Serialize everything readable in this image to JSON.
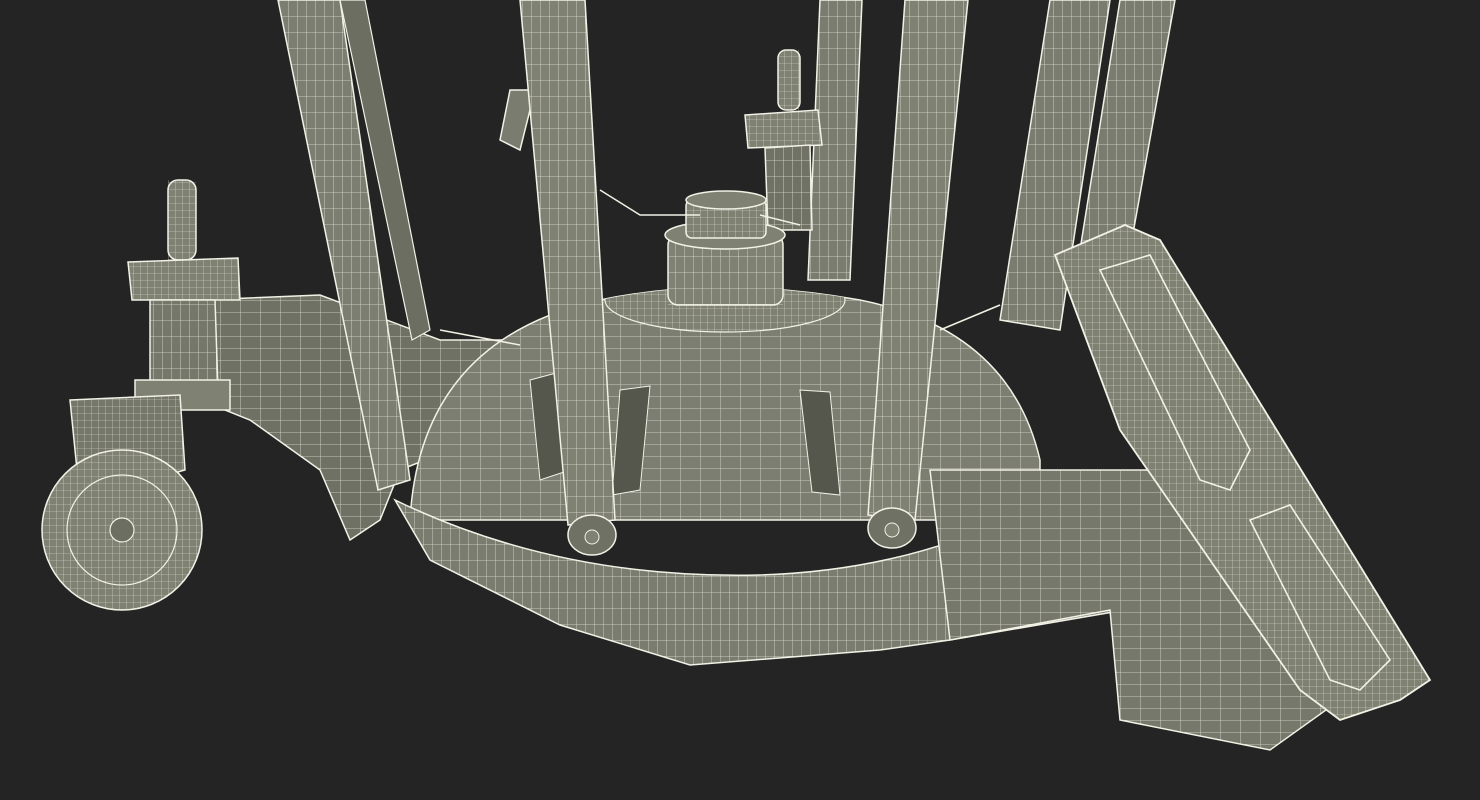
{
  "scene": {
    "background_color": "#242424",
    "surface_color": "#7f8173",
    "surface_shade_color": "#6c6e62",
    "wire_color": "#f2f1e6",
    "subject": "wireframe-render-of-wheeled-camera-dolly-base"
  }
}
